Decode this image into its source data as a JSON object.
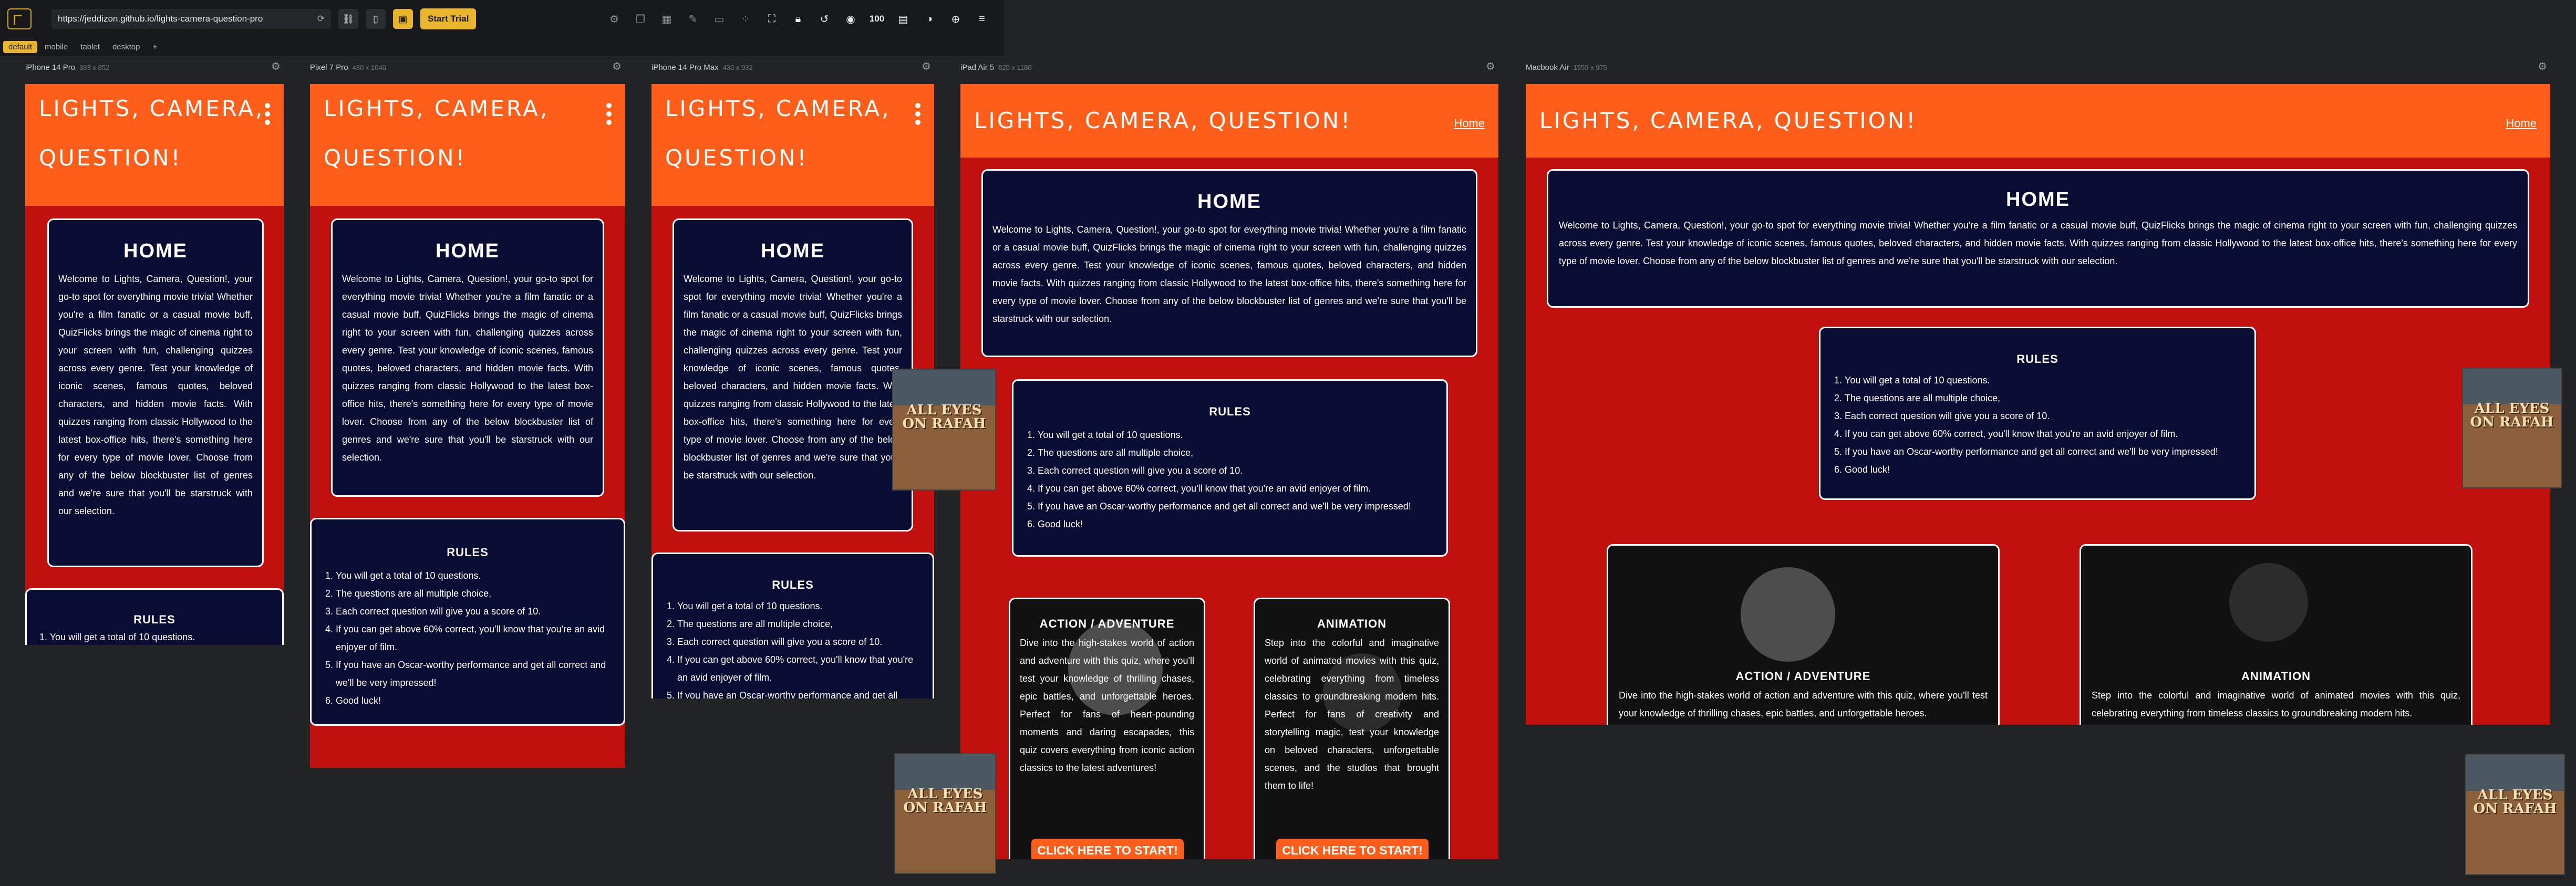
{
  "toolbar": {
    "url": "https://jeddizon.github.io/lights-camera-question-pro",
    "start_trial": "Start Trial",
    "zoom": "100"
  },
  "presets": [
    "default",
    "mobile",
    "tablet",
    "desktop",
    "+"
  ],
  "devices": [
    {
      "name": "iPhone 14 Pro",
      "size": "393 x 852"
    },
    {
      "name": "Pixel 7 Pro",
      "size": "480 x 1040"
    },
    {
      "name": "iPhone 14 Pro Max",
      "size": "430 x 932"
    },
    {
      "name": "iPad Air 5",
      "size": "820 x 1180"
    },
    {
      "name": "Macbook Air",
      "size": "1559 x 975"
    }
  ],
  "site": {
    "brand": "LIGHTS, CAMERA, QUESTION!",
    "brand_line1": "LIGHTS, CAMERA,",
    "brand_line2": "QUESTION!",
    "nav_home": "Home",
    "home_title": "HOME",
    "home_text": "Welcome to Lights, Camera, Question!, your go-to spot for everything movie trivia! Whether you're a film fanatic or a casual movie buff, QuizFlicks brings the magic of cinema right to your screen with fun, challenging quizzes across every genre. Test your knowledge of iconic scenes, famous quotes, beloved characters, and hidden movie facts. With quizzes ranging from classic Hollywood to the latest box-office hits, there's something here for every type of movie lover. Choose from any of the below blockbuster list of genres and we're sure that you'll be starstruck with our selection.",
    "rules_title": "RULES",
    "rules": [
      "You will get a total of 10 questions.",
      "The questions are all multiple choice,",
      "Each correct question will give you a score of 10.",
      "If you can get above 60% correct, you'll know that you're an avid enjoyer of film.",
      "If you have an Oscar-worthy performance and get all correct and we'll be very impressed!",
      "Good luck!"
    ],
    "rules_first_cut": "1. You will get a total of 10 questions.",
    "rules_cut_line": "4. If you have an Oscar-worthy performance and get all",
    "cat_action_title": "ACTION / ADVENTURE",
    "cat_action_text": "Dive into the high-stakes world of action and adventure with this quiz, where you'll test your knowledge of thrilling chases, epic battles, and unforgettable heroes. Perfect for fans of heart-pounding moments and daring escapades, this quiz covers everything from iconic action classics to the latest adventures!",
    "cat_action_short": "Dive into the high-stakes world of action and adventure with this quiz, where you'll test your knowledge of thrilling chases, epic battles, and unforgettable heroes.",
    "cat_anim_title": "ANIMATION",
    "cat_anim_text": "Step into the colorful and imaginative world of animated movies with this quiz, celebrating everything from timeless classics to groundbreaking modern hits. Perfect for fans of creativity and storytelling magic, test your knowledge on beloved characters, unforgettable scenes, and the studios that brought them to life!",
    "cat_anim_short": "Step into the colorful and imaginative world of animated movies with this quiz, celebrating everything from timeless classics to groundbreaking modern hits.",
    "cta": "CLICK HERE TO START!"
  },
  "thumbnail_text": "ALL EYES ON RAFAH"
}
